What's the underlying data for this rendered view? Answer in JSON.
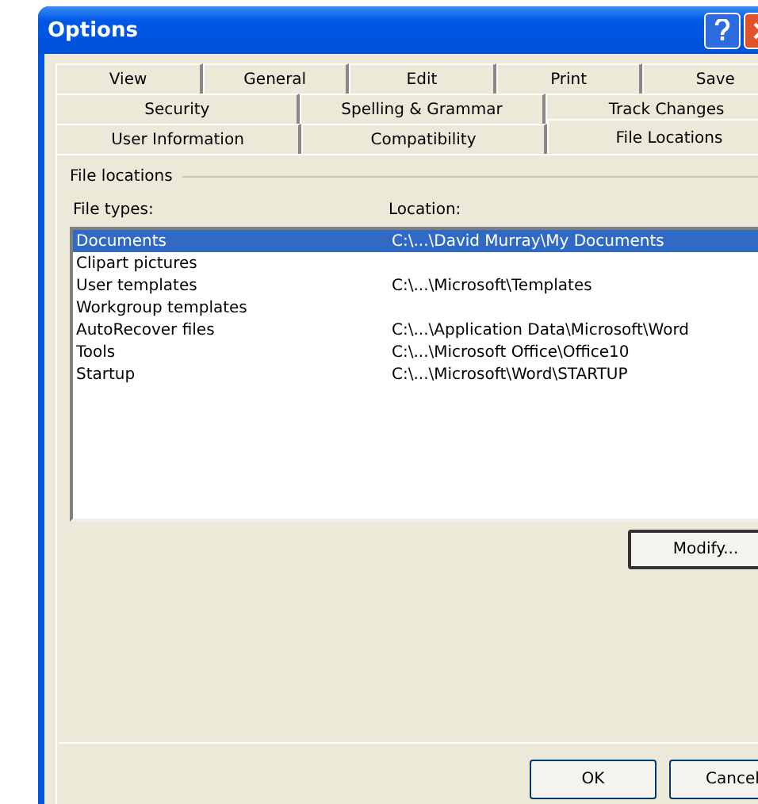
{
  "window": {
    "title": "Options"
  },
  "tab_rows": [
    [
      {
        "label": "View",
        "selected": false
      },
      {
        "label": "General",
        "selected": false
      },
      {
        "label": "Edit",
        "selected": false
      },
      {
        "label": "Print",
        "selected": false
      },
      {
        "label": "Save",
        "selected": false
      }
    ],
    [
      {
        "label": "Security",
        "selected": false
      },
      {
        "label": "Spelling & Grammar",
        "selected": false
      },
      {
        "label": "Track Changes",
        "selected": false
      }
    ],
    [
      {
        "label": "User Information",
        "selected": false
      },
      {
        "label": "Compatibility",
        "selected": false
      },
      {
        "label": "File Locations",
        "selected": true
      }
    ]
  ],
  "group_title": "File locations",
  "columns": [
    "File types:",
    "Location:"
  ],
  "rows": [
    {
      "type": "Documents",
      "location": "C:\\...\\David Murray\\My Documents",
      "selected": true
    },
    {
      "type": "Clipart pictures",
      "location": "",
      "selected": false
    },
    {
      "type": "User templates",
      "location": "C:\\...\\Microsoft\\Templates",
      "selected": false
    },
    {
      "type": "Workgroup templates",
      "location": "",
      "selected": false
    },
    {
      "type": "AutoRecover files",
      "location": "C:\\...\\Application Data\\Microsoft\\Word",
      "selected": false
    },
    {
      "type": "Tools",
      "location": "C:\\...\\Microsoft Office\\Office10",
      "selected": false
    },
    {
      "type": "Startup",
      "location": "C:\\...\\Microsoft\\Word\\STARTUP",
      "selected": false
    }
  ],
  "modify_button": "Modify...",
  "buttons": [
    "OK",
    "Cancel"
  ]
}
